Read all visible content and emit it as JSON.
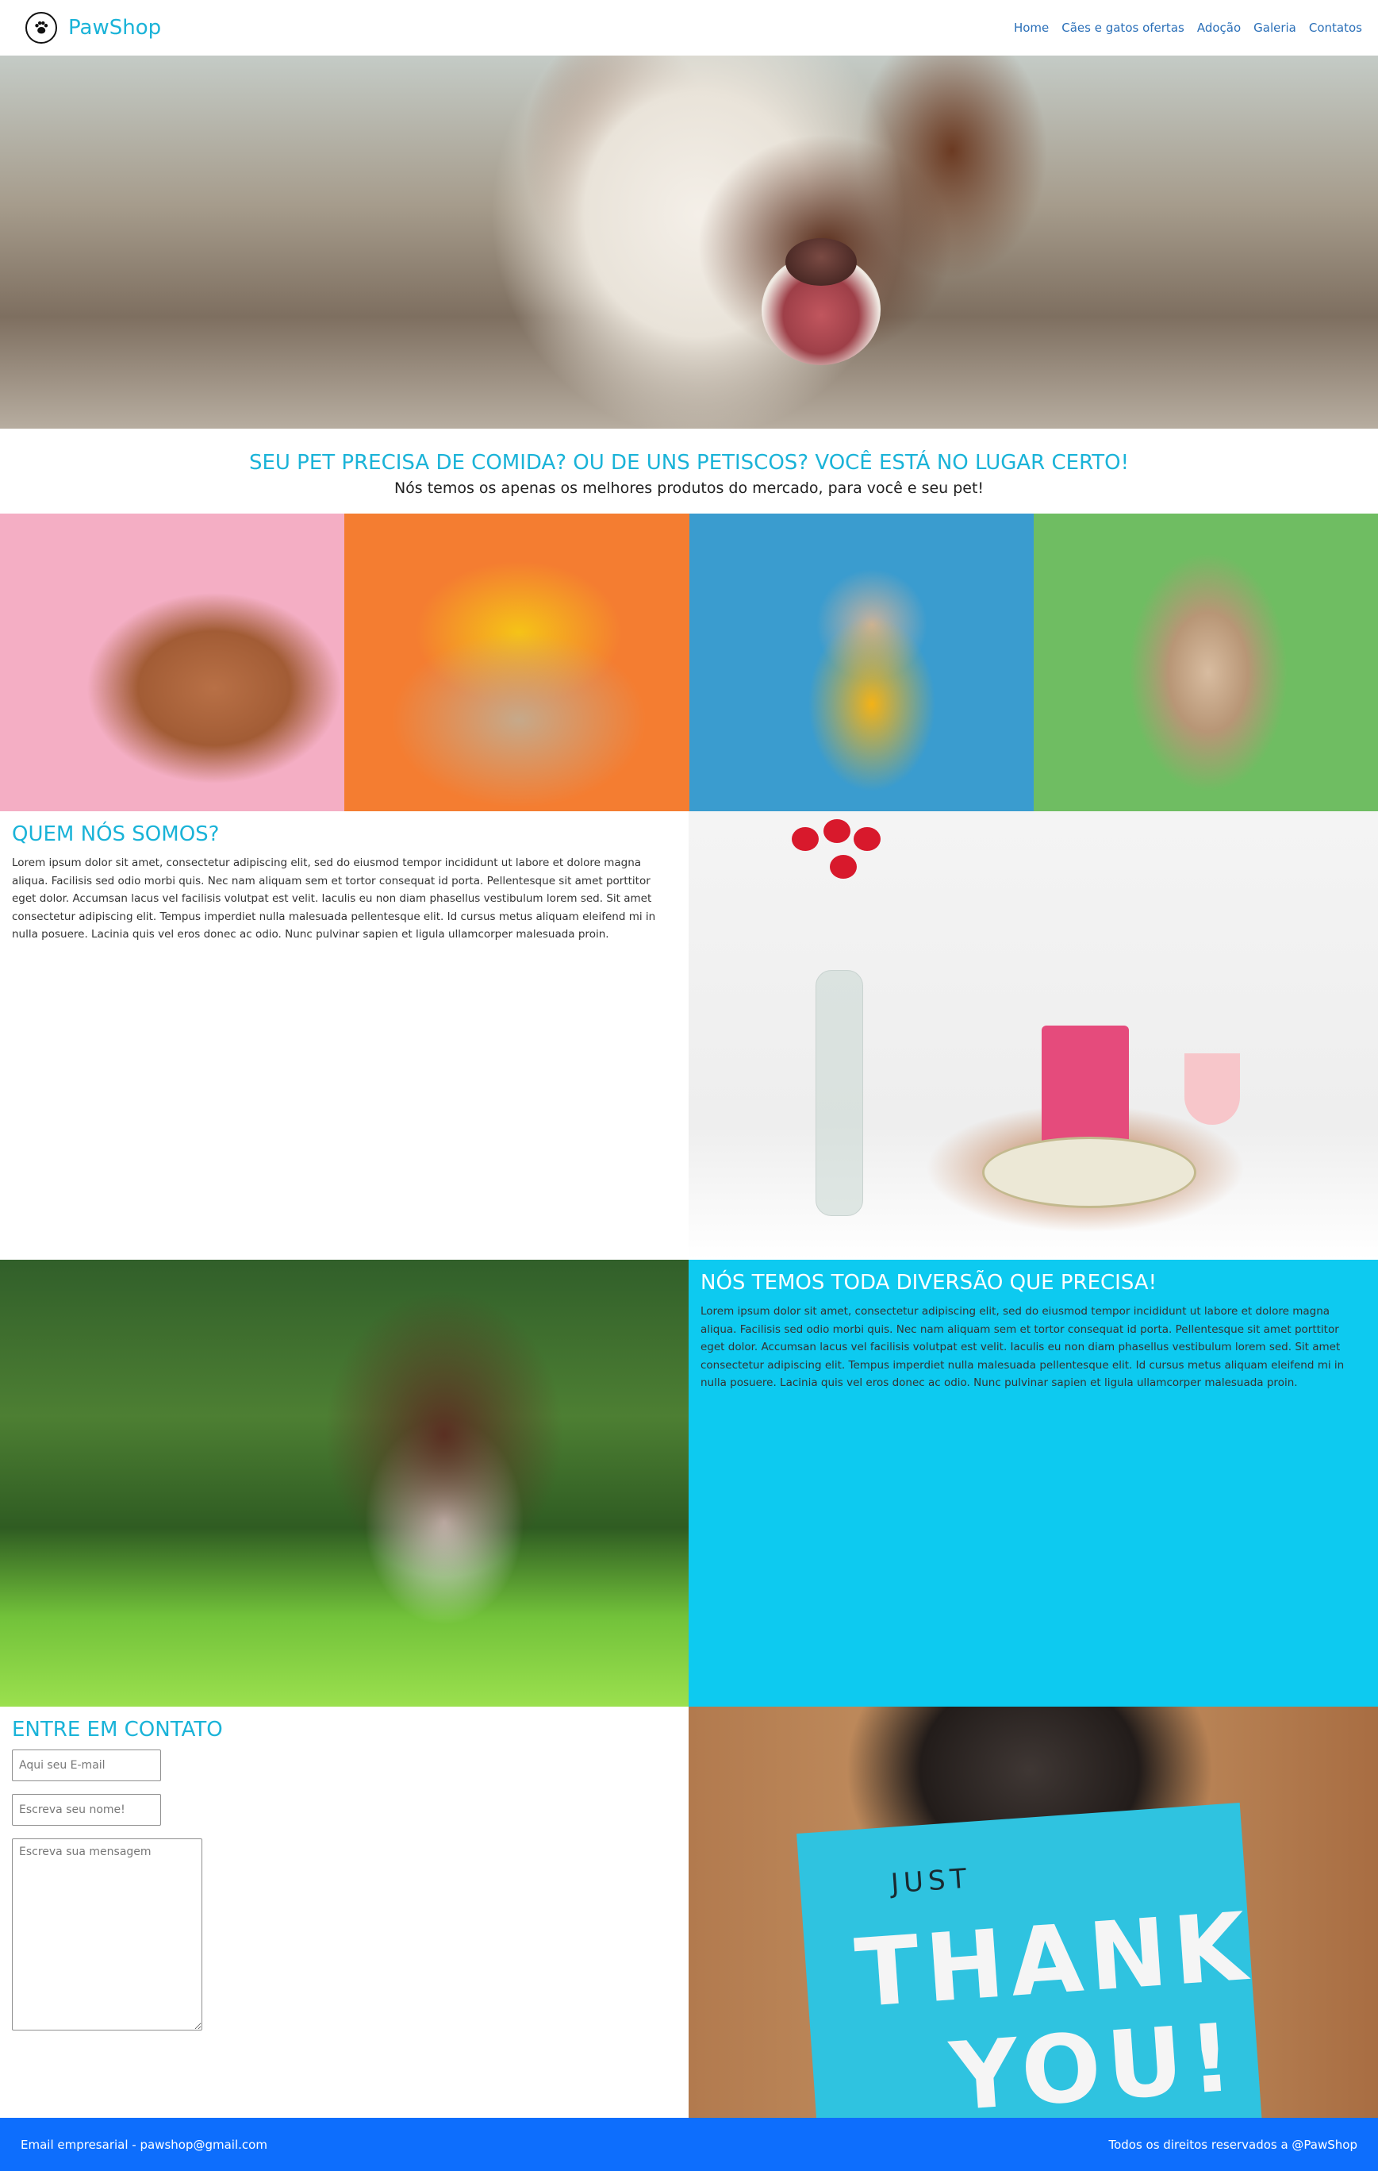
{
  "brand": {
    "name": "PawShop",
    "logo_icon": "paw-icon"
  },
  "nav": {
    "links": [
      "Home",
      "Cães e gatos ofertas",
      "Adoção",
      "Galeria",
      "Contatos"
    ]
  },
  "tagline": {
    "title": "SEU PET PRECISA DE COMIDA? OU DE UNS PETISCOS? VOCÊ ESTÁ NO LUGAR CERTO!",
    "subtitle": "Nós temos os apenas os melhores produtos do mercado, para você e seu pet!"
  },
  "about": {
    "title": "QUEM NÓS SOMOS?",
    "body": "Lorem ipsum dolor sit amet, consectetur adipiscing elit, sed do eiusmod tempor incididunt ut labore et dolore magna aliqua. Facilisis sed odio morbi quis. Nec nam aliquam sem et tortor consequat id porta. Pellentesque sit amet porttitor eget dolor. Accumsan lacus vel facilisis volutpat est velit. Iaculis eu non diam phasellus vestibulum lorem sed. Sit amet consectetur adipiscing elit. Tempus imperdiet nulla malesuada pellentesque elit. Id cursus metus aliquam eleifend mi in nulla posuere. Lacinia quis vel eros donec ac odio. Nunc pulvinar sapien et ligula ullamcorper malesuada proin."
  },
  "fun": {
    "title": "NÓS TEMOS TODA DIVERSÃO QUE PRECISA!",
    "body": "Lorem ipsum dolor sit amet, consectetur adipiscing elit, sed do eiusmod tempor incididunt ut labore et dolore magna aliqua. Facilisis sed odio morbi quis. Nec nam aliquam sem et tortor consequat id porta. Pellentesque sit amet porttitor eget dolor. Accumsan lacus vel facilisis volutpat est velit. Iaculis eu non diam phasellus vestibulum lorem sed. Sit amet consectetur adipiscing elit. Tempus imperdiet nulla malesuada pellentesque elit. Id cursus metus aliquam eleifend mi in nulla posuere. Lacinia quis vel eros donec ac odio. Nunc pulvinar sapien et ligula ullamcorper malesuada proin."
  },
  "contact": {
    "title": "ENTRE EM CONTATO",
    "email_placeholder": "Aqui seu E-mail",
    "name_placeholder": "Escreva seu nome!",
    "message_placeholder": "Escreva sua mensagem"
  },
  "thank_card": {
    "top": "JUST",
    "line1": "THANK",
    "line2": "YOU!"
  },
  "footer": {
    "left": "Email empresarial - pawshop@gmail.com",
    "right": "Todos os direitos reservados a @PawShop"
  },
  "colors": {
    "accent": "#1ab3d8",
    "nav_link": "#2a6fb8",
    "fun_bg": "#0dcaf0",
    "footer_bg": "#0d6efd"
  }
}
